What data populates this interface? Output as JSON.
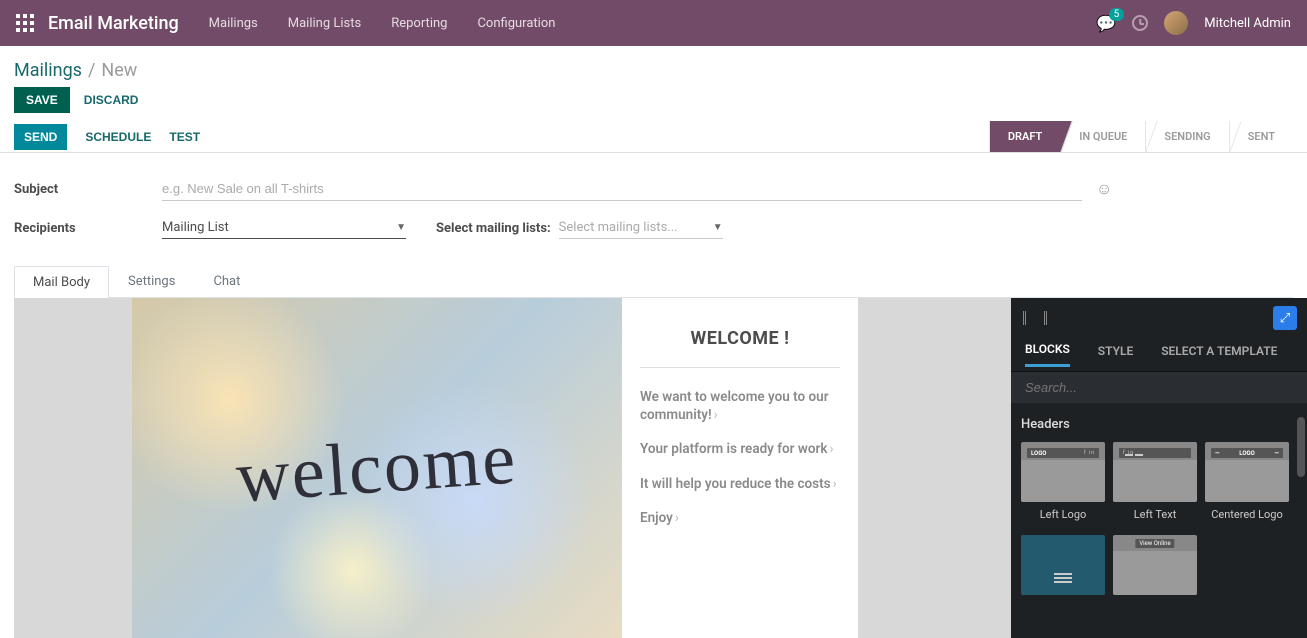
{
  "topnav": {
    "brand": "Email Marketing",
    "links": [
      "Mailings",
      "Mailing Lists",
      "Reporting",
      "Configuration"
    ],
    "badge": "5",
    "username": "Mitchell Admin"
  },
  "breadcrumb": {
    "root": "Mailings",
    "current": "New"
  },
  "buttons": {
    "save": "SAVE",
    "discard": "DISCARD"
  },
  "actions": {
    "send": "SEND",
    "schedule": "SCHEDULE",
    "test": "TEST"
  },
  "stages": [
    "DRAFT",
    "IN QUEUE",
    "SENDING",
    "SENT"
  ],
  "active_stage": 0,
  "form": {
    "subject_label": "Subject",
    "subject_placeholder": "e.g. New Sale on all T-shirts",
    "recipients_label": "Recipients",
    "recipients_value": "Mailing List",
    "select_lists_label": "Select mailing lists:",
    "select_lists_placeholder": "Select mailing lists..."
  },
  "tabs": [
    "Mail Body",
    "Settings",
    "Chat"
  ],
  "active_tab": 0,
  "mailbody": {
    "image_word": "welcome",
    "heading": "WELCOME !",
    "p1": "We want to welcome you to our community!",
    "p2": "Your platform is ready for work",
    "p3": "It will help you reduce the costs",
    "p4": "Enjoy"
  },
  "editor": {
    "tabs": [
      "BLOCKS",
      "STYLE",
      "SELECT A TEMPLATE"
    ],
    "active_tab": 0,
    "search_placeholder": "Search...",
    "section": "Headers",
    "blocks_row1": [
      "Left Logo",
      "Left Text",
      "Centered Logo"
    ],
    "logo_text": "LOGO",
    "social_text": "f in ",
    "view_online": "View Online"
  }
}
